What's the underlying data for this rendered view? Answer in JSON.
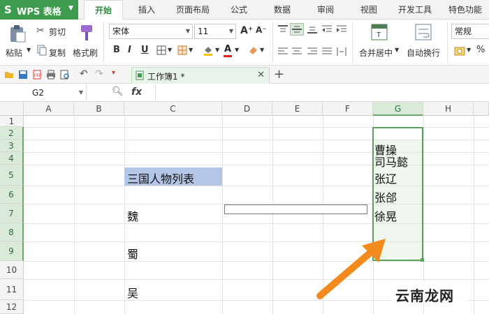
{
  "app": {
    "name": "WPS 表格",
    "logo": "S"
  },
  "menu_tabs": [
    "开始",
    "插入",
    "页面布局",
    "公式",
    "数据",
    "审阅",
    "视图",
    "开发工具",
    "特色功能"
  ],
  "ribbon": {
    "paste_label": "粘贴",
    "cut_label": "剪切",
    "copy_label": "复制",
    "format_painter_label": "格式刷",
    "font_name": "宋体",
    "font_size": "11",
    "bold": "B",
    "italic": "I",
    "underline": "U",
    "font_color_glyph": "A",
    "merge_center_label": "合并居中",
    "wrap_text_label": "自动换行",
    "number_format": "常规",
    "percent_glyph": "%",
    "grow_font": "A⁺",
    "shrink_font": "A⁻"
  },
  "document_tab": {
    "name": "工作簿1 *",
    "close_glyph": "✕",
    "new_tab_glyph": "+"
  },
  "formula_bar": {
    "name_box": "G2",
    "fx_label": "fx",
    "formula": ""
  },
  "sheet": {
    "columns": [
      "A",
      "B",
      "C",
      "D",
      "E",
      "F",
      "G",
      "H"
    ],
    "rows": [
      "1",
      "2",
      "3",
      "4",
      "5",
      "6",
      "7",
      "8",
      "9",
      "10",
      "11",
      "12"
    ],
    "selected_column": "G",
    "cells": {
      "C5": "三国人物列表",
      "C7": "魏",
      "C9": "蜀",
      "C11": "吴",
      "G3": "曹操",
      "G4": "司马懿",
      "G5": "张辽",
      "G6": "张郃",
      "G7": "徐晃"
    },
    "title_fill_color": "#b4c6e7",
    "selection_color": "#5aa05f"
  },
  "annotation": {
    "arrow_color": "#f28a1d"
  },
  "watermark": "云南龙网"
}
